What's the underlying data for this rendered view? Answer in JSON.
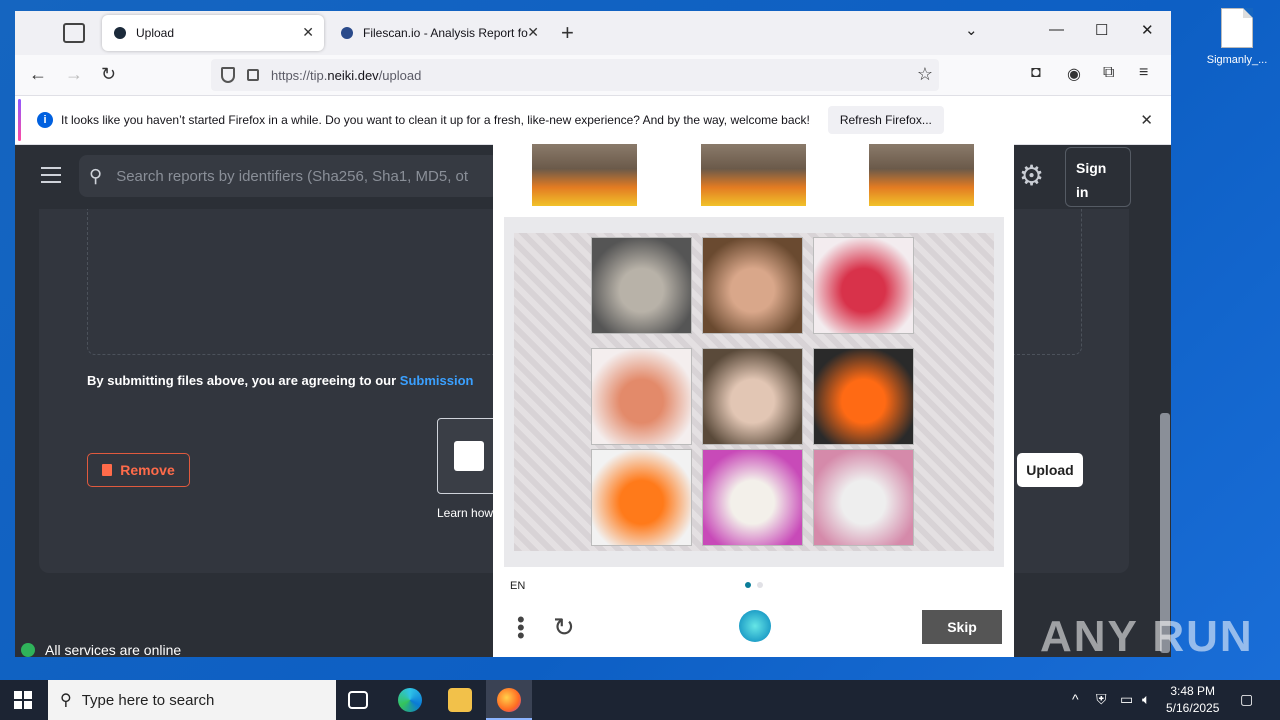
{
  "desktop": {
    "icon_label": "Sigmanly_..."
  },
  "browser": {
    "tabs": [
      {
        "label": "Upload",
        "active": true
      },
      {
        "label": "Filescan.io - Analysis Report for",
        "active": false
      }
    ],
    "url_prefix": "https://tip.",
    "url_domain": "neiki.dev",
    "url_suffix": "/upload",
    "notification": {
      "message": "It looks like you haven’t started Firefox in a while. Do you want to clean it up for a fresh, like-new experience? And by the way, welcome back!",
      "button": "Refresh Firefox..."
    }
  },
  "page": {
    "search_placeholder": "Search reports by identifiers (Sha256, Sha1, MD5, ot",
    "signin_label": "Sign in",
    "agree_text": "By submitting files above, you are agreeing to our ",
    "agree_link": "Submission",
    "remove_label": "Remove",
    "learn_label": "Learn how",
    "upload_label": "Upload",
    "status_text": "All services are online"
  },
  "captcha": {
    "lang": "EN",
    "skip_label": "Skip",
    "cells": [
      {
        "subject": "goat",
        "colors": [
          "#555",
          "#b8b2a8"
        ]
      },
      {
        "subject": "pig",
        "colors": [
          "#6a4a30",
          "#d9a78a"
        ]
      },
      {
        "subject": "flower-lei",
        "colors": [
          "#f3ecef",
          "#d8324a"
        ]
      },
      {
        "subject": "flower-lei",
        "colors": [
          "#f4eeee",
          "#e38a6a"
        ]
      },
      {
        "subject": "pig",
        "colors": [
          "#5a4a3a",
          "#e2c6b4"
        ]
      },
      {
        "subject": "safety-vest",
        "colors": [
          "#2a2a2a",
          "#ff6a14"
        ]
      },
      {
        "subject": "safety-vest",
        "colors": [
          "#f2f2f2",
          "#ff7a1a"
        ]
      },
      {
        "subject": "goat",
        "colors": [
          "#c84ab8",
          "#f3f0ea"
        ]
      },
      {
        "subject": "goat",
        "colors": [
          "#d58aaa",
          "#eee"
        ]
      }
    ]
  },
  "watermark": "ANY RUN",
  "taskbar": {
    "search_placeholder": "Type here to search",
    "time": "3:48 PM",
    "date": "5/16/2025"
  }
}
